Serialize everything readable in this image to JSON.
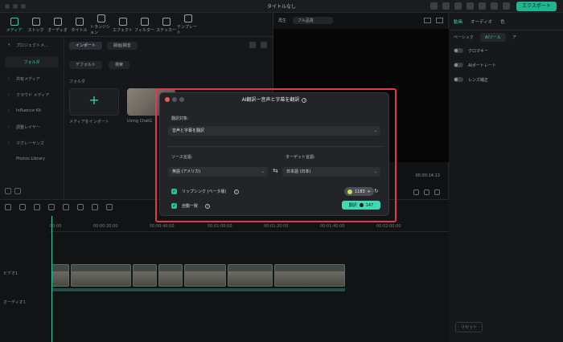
{
  "titlebar": {
    "title": "タイトルなし",
    "export_label": "エクスポート"
  },
  "media_tabs": [
    {
      "label": "メディア",
      "icon": "media-icon",
      "active": true
    },
    {
      "label": "ストック",
      "icon": "stock-icon"
    },
    {
      "label": "オーディオ",
      "icon": "audio-icon"
    },
    {
      "label": "タイトル",
      "icon": "title-icon"
    },
    {
      "label": "トランジション",
      "icon": "transition-icon"
    },
    {
      "label": "エフェクト",
      "icon": "effect-icon"
    },
    {
      "label": "フィルター",
      "icon": "filter-icon"
    },
    {
      "label": "ステッカー",
      "icon": "sticker-icon"
    },
    {
      "label": "テンプレート",
      "icon": "template-icon"
    }
  ],
  "sidebar": {
    "items": [
      {
        "label": "プロジェクトメ..."
      },
      {
        "label": "フォルダ",
        "active": true
      },
      {
        "label": "共有メディア"
      },
      {
        "label": "クラウド メディア"
      },
      {
        "label": "Influence Kit"
      },
      {
        "label": "調整レイヤー"
      },
      {
        "label": "マグレーヤンズ"
      },
      {
        "label": "Photos Library"
      }
    ]
  },
  "media": {
    "import_chip": "インポート",
    "record_chip": "録画|録音",
    "sort_label": "デフォルト",
    "search_placeholder": "検索",
    "folder_label": "フォルダ",
    "import_tile_label": "メディアをインポート",
    "thumb_label": "Using ChatG"
  },
  "preview": {
    "play_label": "再生",
    "quality_label": "フル品質",
    "timecode": "00:00:14:13"
  },
  "inspector": {
    "tabs": [
      "動画",
      "オーディオ",
      "色"
    ],
    "subtabs": [
      "ベーシック",
      "AIツール",
      "ア"
    ],
    "rows": [
      "クロマキー",
      "AIポートレート",
      "レンズ補正"
    ],
    "reset_label": "リセット"
  },
  "timeline": {
    "ruler": [
      "00:00",
      "00:00:20:00",
      "00:00:40:00",
      "00:01:00:00",
      "00:01:20:00",
      "00:01:40:00",
      "00:02:00:00"
    ],
    "video_track": "ビデオ1",
    "audio_track": "オーディオ1"
  },
  "dialog": {
    "title": "AI翻訳ー音声と字幕を翻訳",
    "target_label": "翻訳対象:",
    "target_value": "音声と字幕を翻訳",
    "source_label": "ソース言語:",
    "source_value": "英語 (アメリカ)",
    "dest_label": "ターゲット言語:",
    "dest_value": "日本語 (日本)",
    "lipsync_label": "リップシンク (ベータ版)",
    "lipsync_credits": "1183",
    "auto_label": "自動一致",
    "translate_label": "翻訳",
    "translate_credits": "147"
  }
}
